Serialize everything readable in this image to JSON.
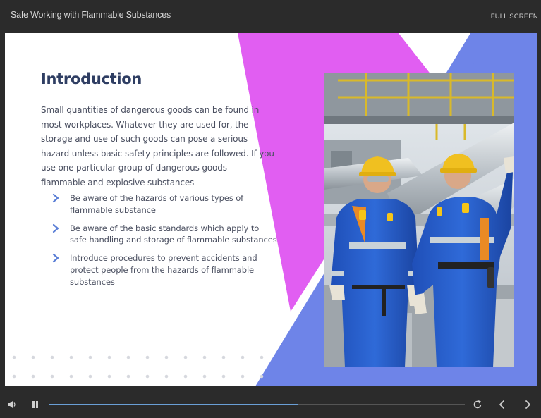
{
  "header": {
    "course_title": "Safe Working with Flammable Substances",
    "fullscreen_label": "FULL SCREEN"
  },
  "slide": {
    "heading": "Introduction",
    "intro": "Small quantities of dangerous goods can be found in most workplaces. Whatever they are used for, the storage and use of such goods can pose a serious hazard unless basic safety principles are followed. If you use one particular group of dangerous goods - flammable and explosive substances -",
    "bullets": [
      "Be aware of the hazards of various types of flammable substance",
      "Be aware of the basic standards which apply to safe handling and storage of flammable substances",
      "Introduce procedures to prevent accidents and protect people from the hazards of flammable substances"
    ],
    "bullet_icon": "chevron-right-icon",
    "image": "two-workers-in-blue-coveralls-and-hard-hats-at-industrial-plant",
    "colors": {
      "heading": "#2f3e63",
      "body_text": "#4a4f60",
      "bullet_chevron": "#5b7fd6",
      "accent_magenta": "#e15ef2",
      "accent_blue": "#6e84e8"
    }
  },
  "player": {
    "progress": 0.6,
    "icons": {
      "volume": "volume-icon",
      "pause": "pause-icon",
      "replay": "replay-icon",
      "previous": "chevron-left-icon",
      "next": "chevron-right-icon"
    },
    "colors": {
      "progress_fill": "#6a9fd6",
      "progress_track": "#555555",
      "bar_background": "#2b2b2b"
    }
  }
}
